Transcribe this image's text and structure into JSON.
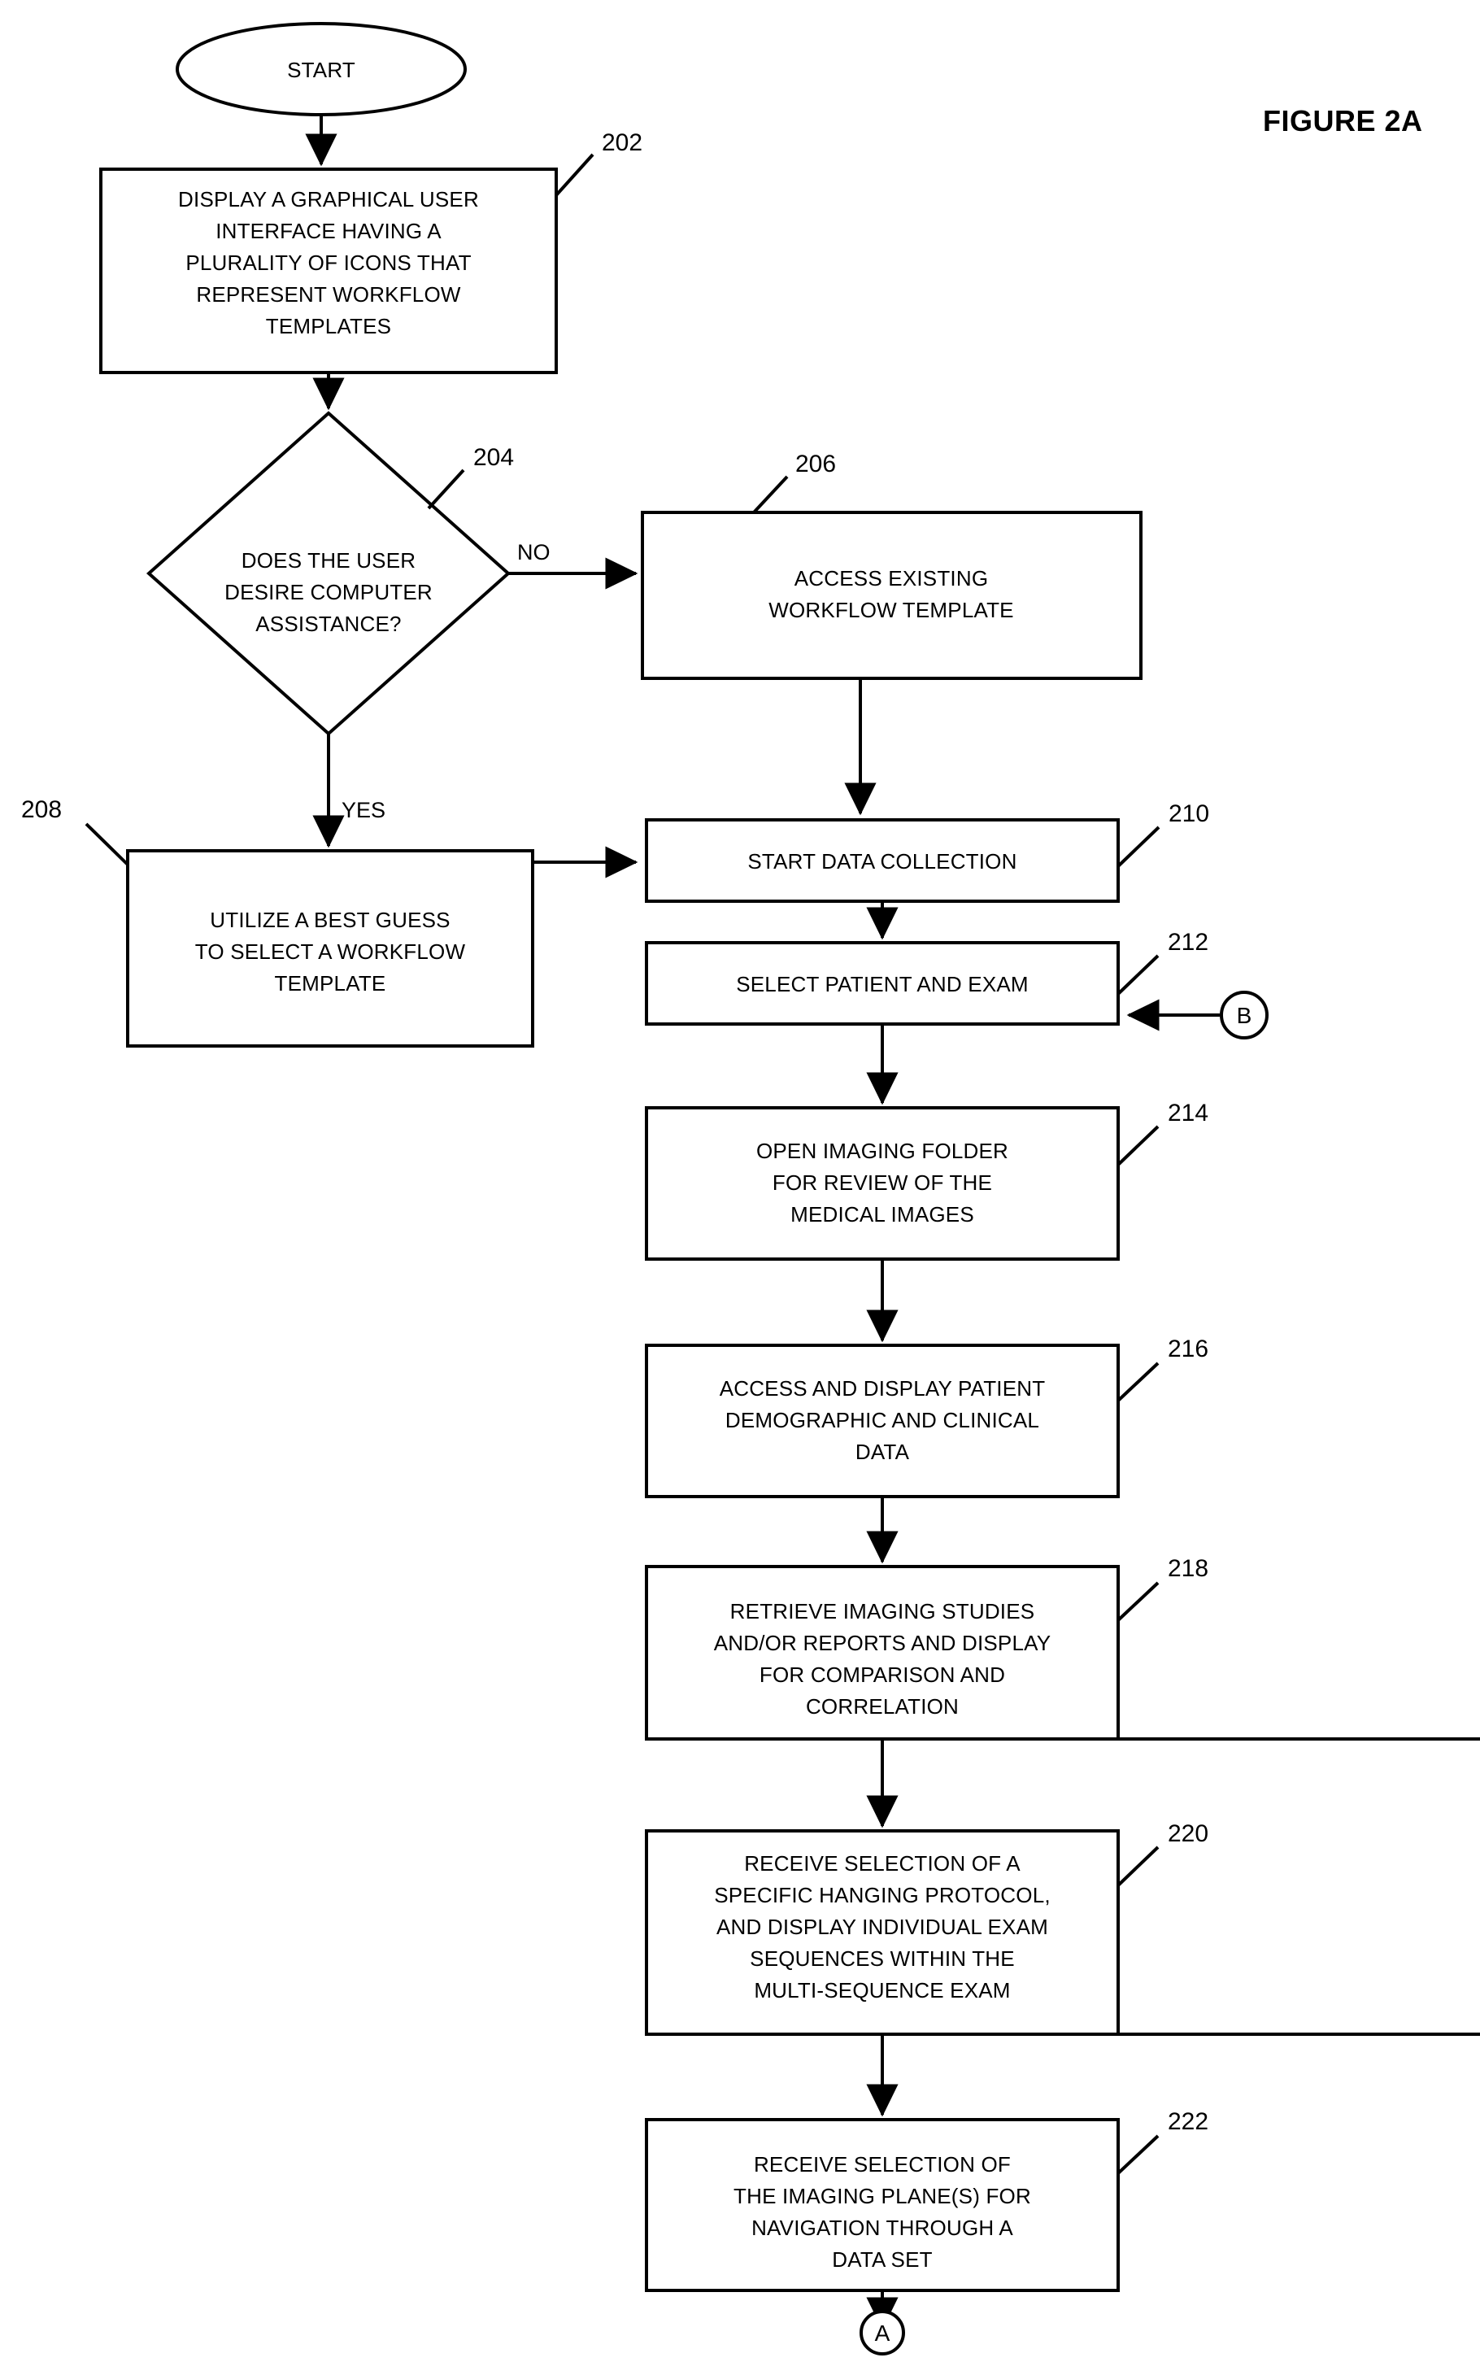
{
  "figure": {
    "title": "FIGURE 2A"
  },
  "terminators": {
    "start": {
      "label": "START"
    },
    "exit_a": {
      "label": "A"
    },
    "entry_b": {
      "label": "B"
    }
  },
  "branch_labels": {
    "no": "NO",
    "yes": "YES"
  },
  "nodes": [
    {
      "ref": "202",
      "kind": "process",
      "lines": [
        "DISPLAY A GRAPHICAL USER",
        "INTERFACE HAVING A",
        "PLURALITY OF ICONS THAT",
        "REPRESENT WORKFLOW",
        "TEMPLATES"
      ]
    },
    {
      "ref": "204",
      "kind": "decision",
      "lines": [
        "DOES THE USER",
        "DESIRE COMPUTER",
        "ASSISTANCE?"
      ]
    },
    {
      "ref": "206",
      "kind": "process",
      "lines": [
        "ACCESS EXISTING",
        "WORKFLOW TEMPLATE"
      ]
    },
    {
      "ref": "208",
      "kind": "process",
      "lines": [
        "UTILIZE A BEST GUESS",
        "TO SELECT A WORKFLOW",
        "TEMPLATE"
      ]
    },
    {
      "ref": "210",
      "kind": "process",
      "lines": [
        "START DATA COLLECTION"
      ]
    },
    {
      "ref": "212",
      "kind": "process",
      "lines": [
        "SELECT PATIENT AND EXAM"
      ]
    },
    {
      "ref": "214",
      "kind": "process",
      "lines": [
        "OPEN IMAGING FOLDER",
        "FOR REVIEW OF THE",
        "MEDICAL IMAGES"
      ]
    },
    {
      "ref": "216",
      "kind": "process",
      "lines": [
        "ACCESS AND DISPLAY PATIENT",
        "DEMOGRAPHIC AND CLINICAL",
        "DATA"
      ]
    },
    {
      "ref": "218",
      "kind": "process",
      "lines": [
        "RETRIEVE IMAGING STUDIES",
        "AND/OR REPORTS AND DISPLAY",
        "FOR COMPARISON AND",
        "CORRELATION"
      ]
    },
    {
      "ref": "220",
      "kind": "process",
      "lines": [
        "RECEIVE SELECTION OF A",
        "SPECIFIC HANGING PROTOCOL,",
        "AND DISPLAY INDIVIDUAL EXAM",
        "SEQUENCES WITHIN THE",
        "MULTI-SEQUENCE EXAM"
      ]
    },
    {
      "ref": "222",
      "kind": "process",
      "lines": [
        "RECEIVE SELECTION OF",
        "THE IMAGING PLANE(S) FOR",
        "NAVIGATION THROUGH A",
        "DATA SET"
      ]
    }
  ],
  "colors": {
    "ink": "#000000",
    "paper": "#ffffff"
  }
}
